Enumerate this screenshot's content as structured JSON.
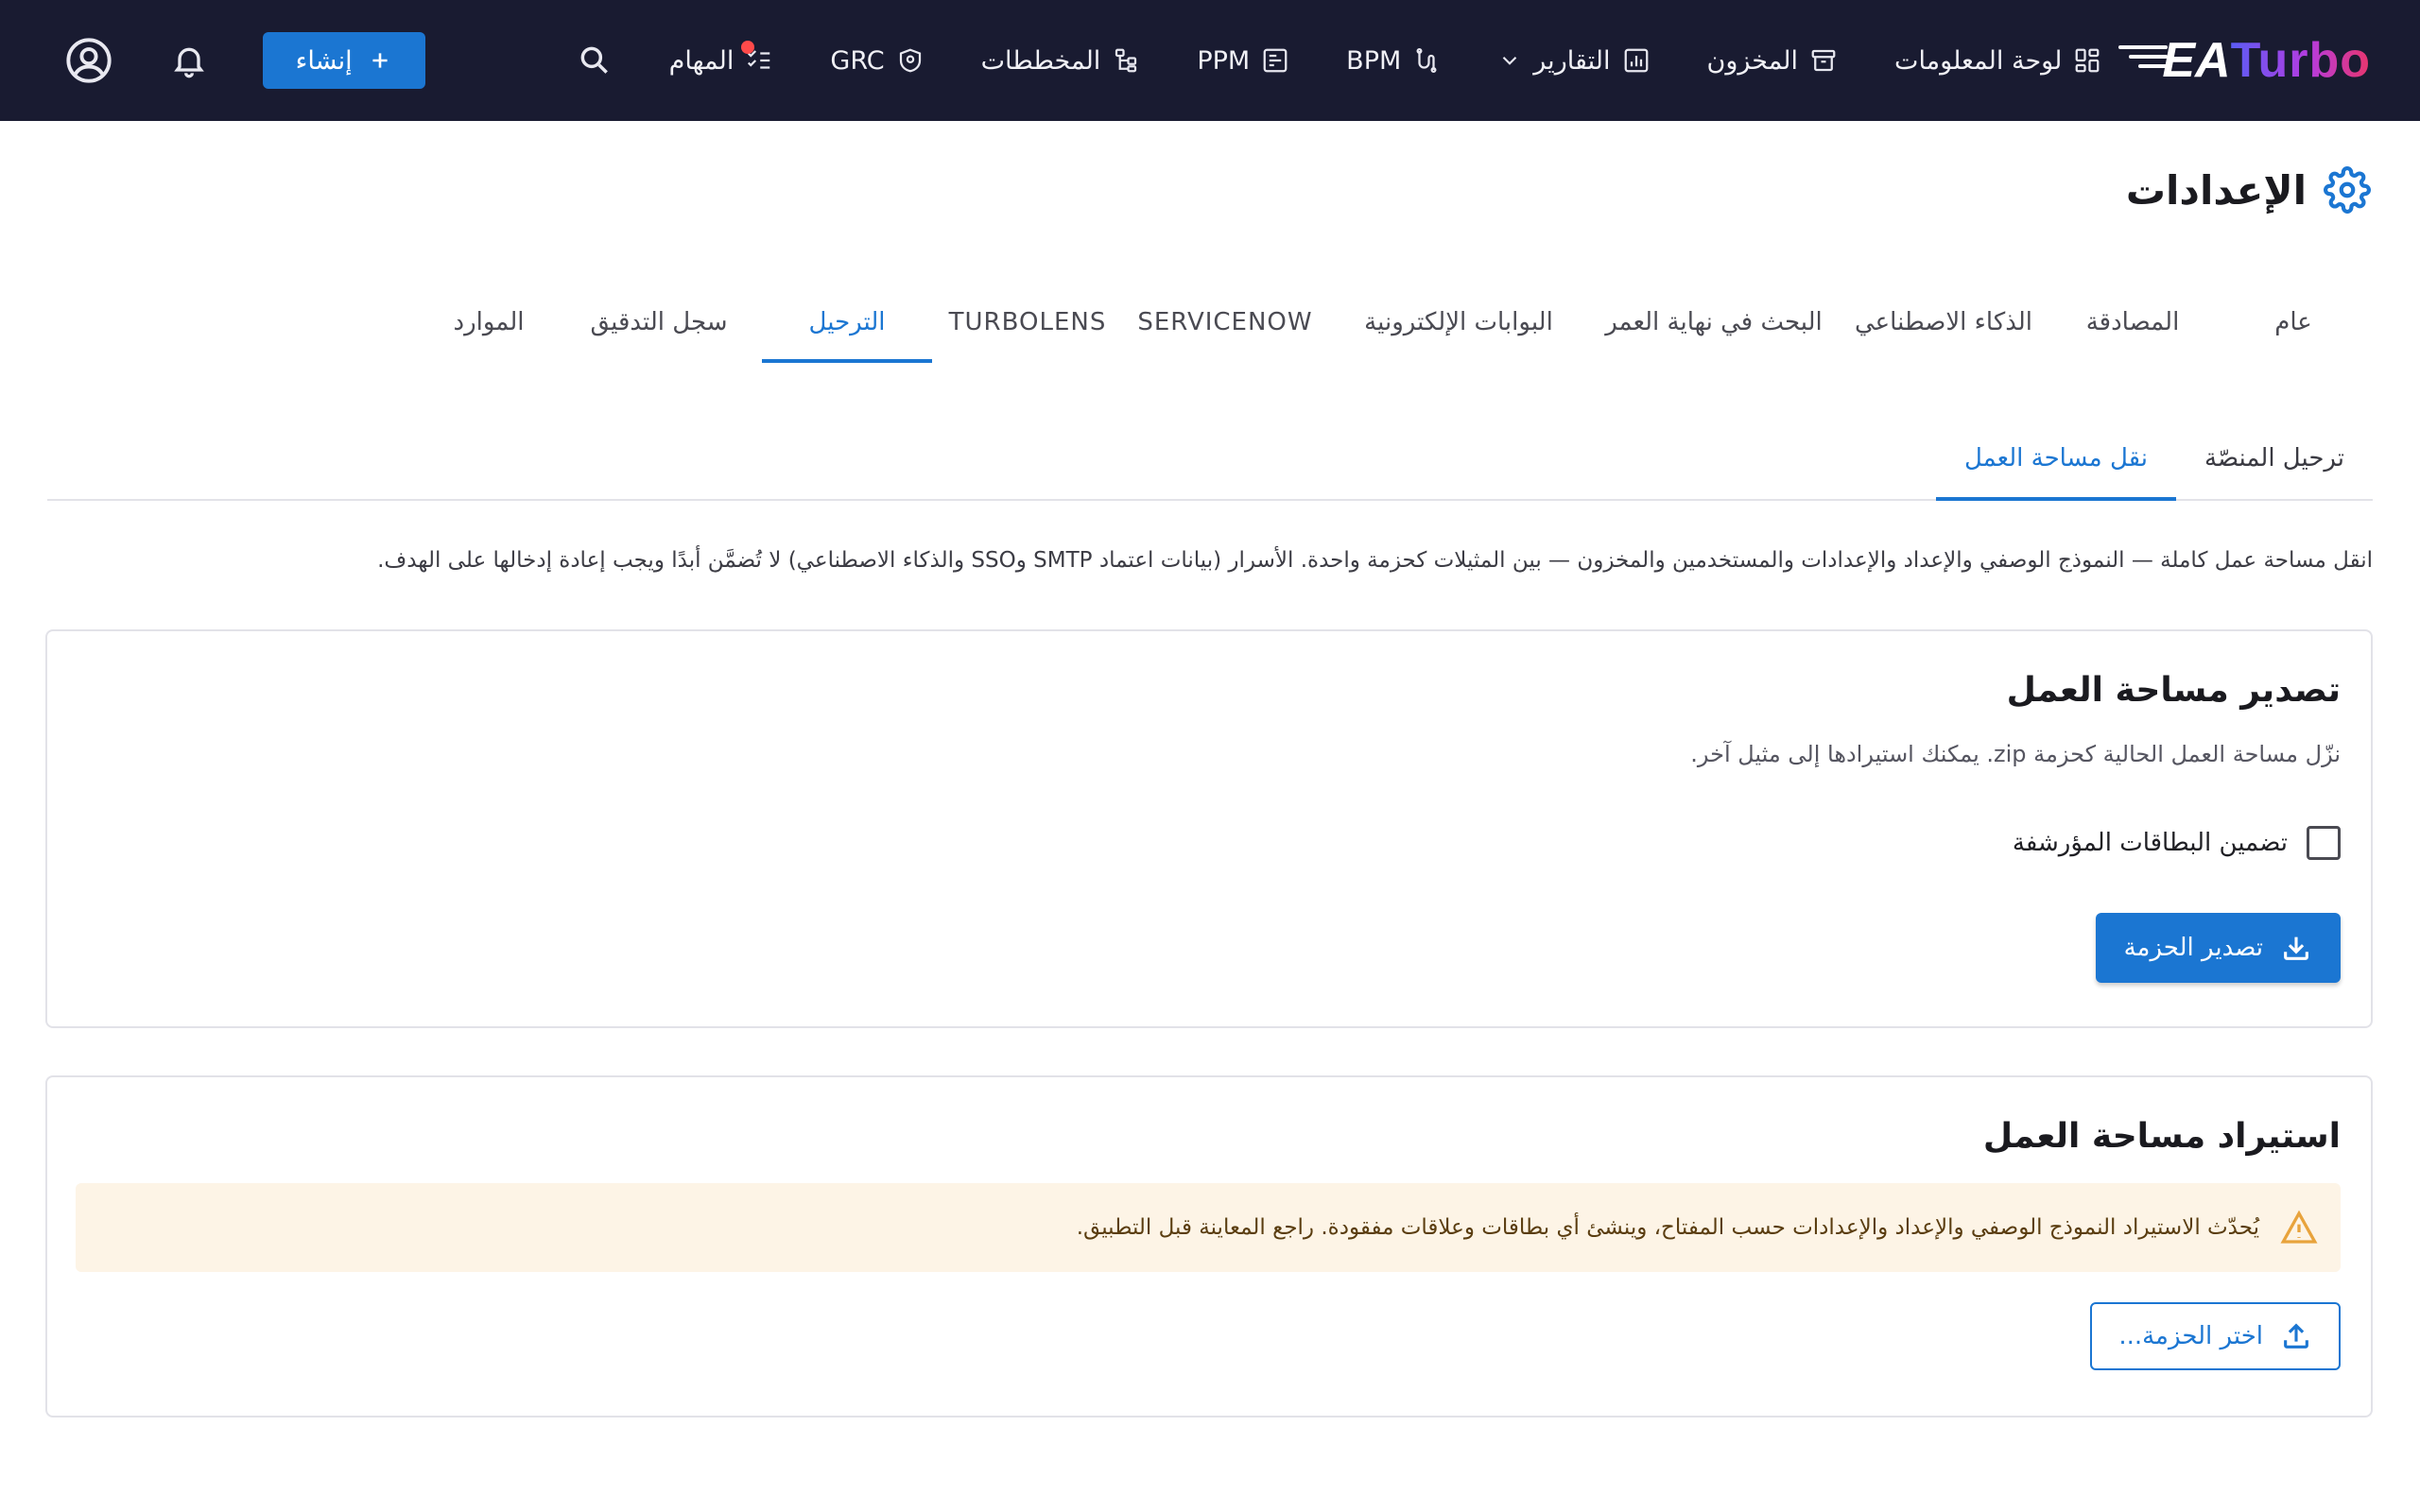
{
  "app": {
    "logo_primary": "Turbo",
    "logo_secondary": "EA"
  },
  "nav": {
    "items": [
      {
        "label": "لوحة المعلومات",
        "icon": "dashboard-icon"
      },
      {
        "label": "المخزون",
        "icon": "inventory-icon"
      },
      {
        "label": "التقارير",
        "icon": "reports-icon",
        "has_dropdown": true
      },
      {
        "label": "BPM",
        "icon": "bpm-icon"
      },
      {
        "label": "PPM",
        "icon": "ppm-icon"
      },
      {
        "label": "المخططات",
        "icon": "diagrams-icon"
      },
      {
        "label": "GRC",
        "icon": "grc-icon"
      },
      {
        "label": "المهام",
        "icon": "tasks-icon",
        "has_notification": true
      }
    ],
    "create_label": "إنشاء"
  },
  "page": {
    "title": "الإعدادات"
  },
  "tabs": [
    {
      "label": "عام",
      "active": false
    },
    {
      "label": "المصادقة",
      "active": false
    },
    {
      "label": "الذكاء الاصطناعي",
      "active": false
    },
    {
      "label": "البحث في نهاية العمر",
      "active": false
    },
    {
      "label": "البوابات الإلكترونية",
      "active": false
    },
    {
      "label": "SERVICENOW",
      "active": false
    },
    {
      "label": "TURBOLENS",
      "active": false
    },
    {
      "label": "الترحيل",
      "active": true
    },
    {
      "label": "سجل التدقيق",
      "active": false
    },
    {
      "label": "الموارد",
      "active": false
    }
  ],
  "subtabs": [
    {
      "label": "ترحيل المنصّة",
      "active": false
    },
    {
      "label": "نقل مساحة العمل",
      "active": true
    }
  ],
  "intro_text": "انقل مساحة عمل كاملة — النموذج الوصفي والإعداد والإعدادات والمستخدمين والمخزون — بين المثيلات كحزمة واحدة. الأسرار (بيانات اعتماد SMTP وSSO والذكاء الاصطناعي) لا تُضمَّن أبدًا ويجب إعادة إدخالها على الهدف.",
  "export": {
    "title": "تصدير مساحة العمل",
    "description": "نزّل مساحة العمل الحالية كحزمة zip. يمكنك استيرادها إلى مثيل آخر.",
    "checkbox_label": "تضمين البطاقات المؤرشفة",
    "checkbox_checked": false,
    "button_label": "تصدير الحزمة"
  },
  "import": {
    "title": "استيراد مساحة العمل",
    "warning": "يُحدّث الاستيراد النموذج الوصفي والإعداد والإعدادات حسب المفتاح، وينشئ أي بطاقات وعلاقات مفقودة. راجع المعاينة قبل التطبيق.",
    "button_label": "اختر الحزمة..."
  },
  "colors": {
    "topbar_bg": "#191b31",
    "accent": "#1b76d2",
    "warning_bg": "#fdf4e6",
    "warning_icon": "#e8a33c",
    "notification": "#ff4a4a"
  }
}
